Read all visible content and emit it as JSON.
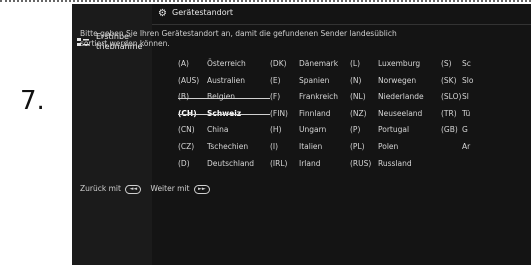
{
  "step_number": "7.",
  "sidebar": {
    "label_line1": "Erstinbe-",
    "label_line2": "triebnahme"
  },
  "header": {
    "title": "Gerätestandort"
  },
  "description": {
    "line1": "Bitte geben Sie Ihren Gerätestandort an, damit die gefundenen Sender landesüblich",
    "line2": "sortiert werden können."
  },
  "countries": [
    [
      {
        "code": "(A)",
        "name": "Österreich"
      },
      {
        "code": "(DK)",
        "name": "Dänemark"
      },
      {
        "code": "(L)",
        "name": "Luxemburg"
      },
      {
        "code": "(S)",
        "name": "Sc"
      }
    ],
    [
      {
        "code": "(AUS)",
        "name": "Australien"
      },
      {
        "code": "(E)",
        "name": "Spanien"
      },
      {
        "code": "(N)",
        "name": "Norwegen"
      },
      {
        "code": "(SK)",
        "name": "Slo"
      }
    ],
    [
      {
        "code": "(B)",
        "name": "Belgien"
      },
      {
        "code": "(F)",
        "name": "Frankreich"
      },
      {
        "code": "(NL)",
        "name": "Niederlande"
      },
      {
        "code": "(SLO)",
        "name": "Sl"
      }
    ],
    [
      {
        "code": "(CH)",
        "name": "Schweiz"
      },
      {
        "code": "(FIN)",
        "name": "Finnland"
      },
      {
        "code": "(NZ)",
        "name": "Neuseeland"
      },
      {
        "code": "(TR)",
        "name": "Tü"
      }
    ],
    [
      {
        "code": "(CN)",
        "name": "China"
      },
      {
        "code": "(H)",
        "name": "Ungarn"
      },
      {
        "code": "(P)",
        "name": "Portugal"
      },
      {
        "code": "(GB)",
        "name": "G"
      }
    ],
    [
      {
        "code": "(CZ)",
        "name": "Tschechien"
      },
      {
        "code": "(I)",
        "name": "Italien"
      },
      {
        "code": "(PL)",
        "name": "Polen"
      },
      {
        "code": "",
        "name": "Ar"
      }
    ],
    [
      {
        "code": "(D)",
        "name": "Deutschland"
      },
      {
        "code": "(IRL)",
        "name": "Irland"
      },
      {
        "code": "(RUS)",
        "name": "Russland"
      },
      {
        "code": "",
        "name": ""
      }
    ]
  ],
  "selected": {
    "code": "(CH)",
    "name": "Schweiz"
  },
  "footer": {
    "back_label": "Zurück mit",
    "next_label": "Weiter mit",
    "back_key": "◄◄",
    "next_key": "►►"
  }
}
